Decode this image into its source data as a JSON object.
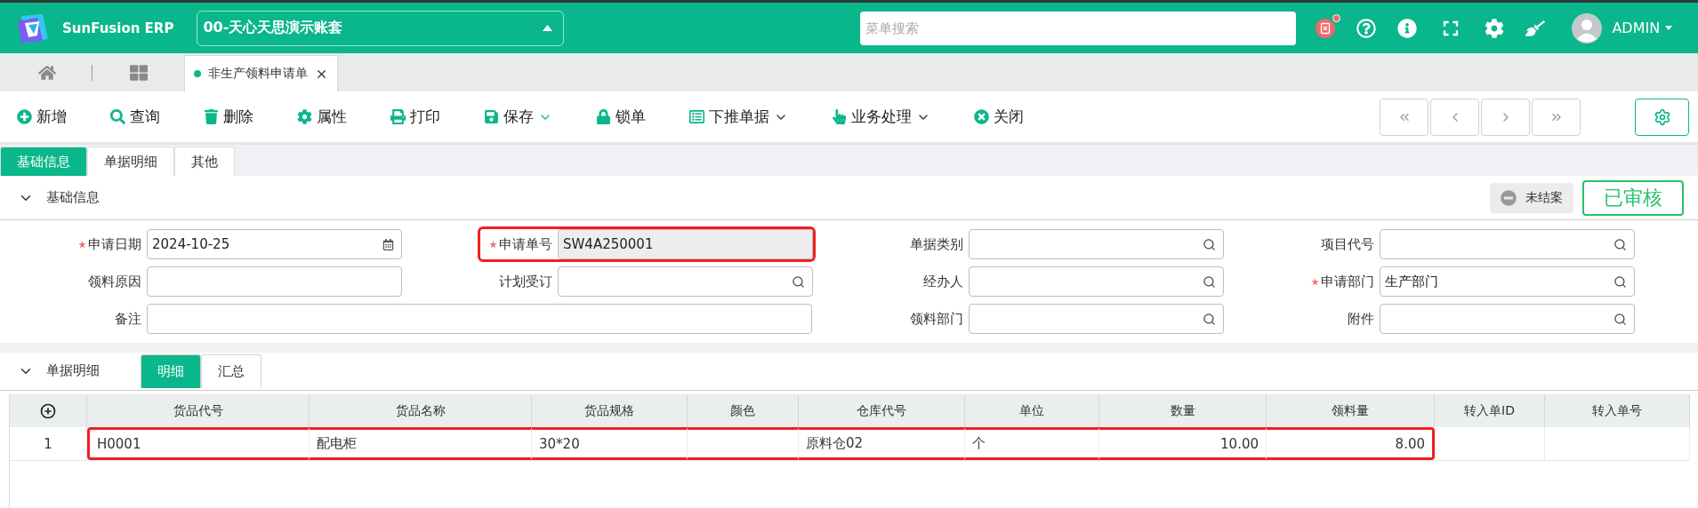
{
  "app": {
    "name": "SunFusion ERP"
  },
  "account_selector": {
    "value": "00-天心天思演示账套"
  },
  "menu_search": {
    "placeholder": "菜单搜索"
  },
  "notification": {
    "unread": true
  },
  "user": {
    "name": "ADMIN"
  },
  "page_tabs": [
    {
      "label": "非生产领料申请单",
      "selected": true
    }
  ],
  "toolbar": [
    {
      "label": "新增",
      "dropdown": false
    },
    {
      "label": "查询",
      "dropdown": false
    },
    {
      "label": "删除",
      "dropdown": false
    },
    {
      "label": "属性",
      "dropdown": false
    },
    {
      "label": "打印",
      "dropdown": false
    },
    {
      "label": "保存",
      "dropdown": true
    },
    {
      "label": "锁单",
      "dropdown": false
    },
    {
      "label": "下推单据",
      "dropdown": true
    },
    {
      "label": "业务处理",
      "dropdown": true
    },
    {
      "label": "关闭",
      "dropdown": false
    }
  ],
  "form_tabs": [
    {
      "label": "基础信息",
      "selected": true
    },
    {
      "label": "单据明细",
      "selected": false
    },
    {
      "label": "其他",
      "selected": false
    }
  ],
  "basic_section": {
    "title": "基础信息",
    "expanded": true,
    "close_status": "未结案",
    "audit_status": "已审核",
    "fields": [
      {
        "label": "申请日期",
        "value": "2024-10-25",
        "kind": "date",
        "required": true,
        "disabled": false,
        "highlighted": false,
        "wide": false
      },
      {
        "label": "申请单号",
        "value": "SW4A250001",
        "kind": "text",
        "required": true,
        "disabled": true,
        "highlighted": true,
        "wide": false
      },
      {
        "label": "单据类别",
        "kind": "lookup",
        "required": false,
        "disabled": false,
        "highlighted": false,
        "wide": false
      },
      {
        "label": "项目代号",
        "kind": "lookup",
        "required": false,
        "disabled": false,
        "highlighted": false,
        "wide": false
      },
      {
        "label": "领料原因",
        "kind": "text",
        "required": false,
        "disabled": false,
        "highlighted": false,
        "wide": false
      },
      {
        "label": "计划受订",
        "kind": "lookup",
        "required": false,
        "disabled": false,
        "highlighted": false,
        "wide": false
      },
      {
        "label": "经办人",
        "kind": "lookup",
        "required": false,
        "disabled": false,
        "highlighted": false,
        "wide": false
      },
      {
        "label": "申请部门",
        "value": "生产部门",
        "kind": "lookup",
        "required": true,
        "disabled": false,
        "highlighted": false,
        "wide": false
      },
      {
        "label": "备注",
        "kind": "text",
        "required": false,
        "disabled": false,
        "highlighted": false,
        "wide": true
      },
      {
        "label": "领料部门",
        "kind": "lookup",
        "required": false,
        "disabled": false,
        "highlighted": false,
        "wide": false
      },
      {
        "label": "附件",
        "kind": "lookup",
        "required": false,
        "disabled": false,
        "highlighted": false,
        "wide": false
      }
    ]
  },
  "detail_section": {
    "title": "单据明细",
    "expanded": true,
    "view_tabs": [
      {
        "label": "明细",
        "selected": true
      },
      {
        "label": "汇总",
        "selected": false
      }
    ],
    "table": {
      "columns": [
        "货品代号",
        "货品名称",
        "货品规格",
        "颜色",
        "仓库代号",
        "单位",
        "数量",
        "领料量",
        "转入单ID",
        "转入单号"
      ],
      "rows": [
        {
          "number": "1",
          "cells": [
            {
              "text": "H0001",
              "highlighted": true
            },
            {
              "text": "配电柜",
              "highlighted": true
            },
            {
              "text": "30*20",
              "highlighted": true
            },
            {
              "highlighted": true
            },
            {
              "text": "原料仓02",
              "highlighted": true
            },
            {
              "text": "个",
              "highlighted": true
            },
            {
              "text": "10.00",
              "highlighted": true
            },
            {
              "text": "8.00",
              "highlighted": true
            },
            {
              "highlighted": false
            },
            {
              "highlighted": false
            }
          ]
        }
      ]
    }
  }
}
